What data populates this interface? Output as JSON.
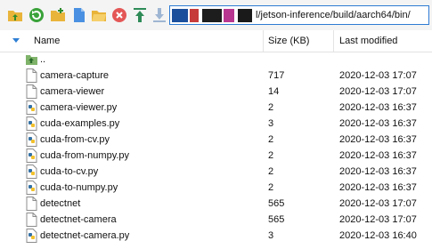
{
  "toolbar": {
    "buttons": [
      {
        "name": "parent-folder-icon"
      },
      {
        "name": "refresh-icon"
      },
      {
        "name": "new-folder-icon"
      },
      {
        "name": "new-file-icon"
      },
      {
        "name": "open-folder-icon"
      },
      {
        "name": "delete-icon"
      },
      {
        "name": "upload-icon"
      },
      {
        "name": "download-icon"
      }
    ],
    "path": "l/jetson-inference/build/aarch64/bin/"
  },
  "columns": {
    "name": "Name",
    "size": "Size (KB)",
    "modified": "Last modified"
  },
  "files": [
    {
      "name": "..",
      "size": "",
      "modified": "",
      "type": "parent"
    },
    {
      "name": "camera-capture",
      "size": "717",
      "modified": "2020-12-03 17:07",
      "type": "file"
    },
    {
      "name": "camera-viewer",
      "size": "14",
      "modified": "2020-12-03 17:07",
      "type": "file"
    },
    {
      "name": "camera-viewer.py",
      "size": "2",
      "modified": "2020-12-03 16:37",
      "type": "python"
    },
    {
      "name": "cuda-examples.py",
      "size": "3",
      "modified": "2020-12-03 16:37",
      "type": "python"
    },
    {
      "name": "cuda-from-cv.py",
      "size": "2",
      "modified": "2020-12-03 16:37",
      "type": "python"
    },
    {
      "name": "cuda-from-numpy.py",
      "size": "2",
      "modified": "2020-12-03 16:37",
      "type": "python"
    },
    {
      "name": "cuda-to-cv.py",
      "size": "2",
      "modified": "2020-12-03 16:37",
      "type": "python"
    },
    {
      "name": "cuda-to-numpy.py",
      "size": "2",
      "modified": "2020-12-03 16:37",
      "type": "python"
    },
    {
      "name": "detectnet",
      "size": "565",
      "modified": "2020-12-03 17:07",
      "type": "file"
    },
    {
      "name": "detectnet-camera",
      "size": "565",
      "modified": "2020-12-03 17:07",
      "type": "file"
    },
    {
      "name": "detectnet-camera.py",
      "size": "3",
      "modified": "2020-12-03 16:40",
      "type": "python"
    }
  ]
}
